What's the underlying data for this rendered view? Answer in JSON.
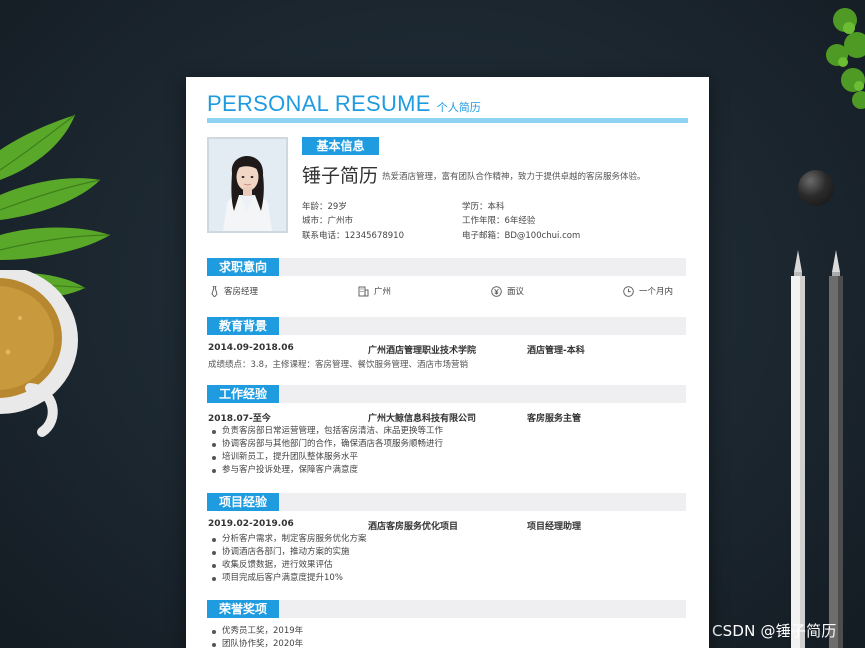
{
  "resume": {
    "title": "PERSONAL RESUME",
    "subtitle": "个人简历",
    "basic_section": "基本信息",
    "name": "锤子简历",
    "intro": "热爱酒店管理，富有团队合作精神，致力于提供卓越的客房服务体验。",
    "info": {
      "age": "年龄：29岁",
      "education": "学历：本科",
      "city": "城市：广州市",
      "years": "工作年限：6年经验",
      "phone": "联系电话：12345678910",
      "email": "电子邮箱：BD@100chui.com"
    },
    "intent_section": "求职意向",
    "intent": {
      "position": "客房经理",
      "location": "广州",
      "salary": "面议",
      "availability": "一个月内"
    },
    "education_section": "教育背景",
    "education": {
      "period": "2014.09-2018.06",
      "school": "广州酒店管理职业技术学院",
      "major": "酒店管理-本科",
      "detail": "成绩绩点：3.8，主修课程：客房管理、餐饮服务管理、酒店市场营销"
    },
    "work_section": "工作经验",
    "work": {
      "period": "2018.07-至今",
      "company": "广州大鲸信息科技有限公司",
      "role": "客房服务主管",
      "items": [
        "负责客房部日常运营管理，包括客房清洁、床品更换等工作",
        "协调客房部与其他部门的合作，确保酒店各项服务顺畅进行",
        "培训新员工，提升团队整体服务水平",
        "参与客户投诉处理，保障客户满意度"
      ]
    },
    "project_section": "项目经验",
    "project": {
      "period": "2019.02-2019.06",
      "name": "酒店客房服务优化项目",
      "role": "项目经理助理",
      "items": [
        "分析客户需求，制定客房服务优化方案",
        "协调酒店各部门，推动方案的实施",
        "收集反馈数据，进行效果评估",
        "项目完成后客户满意度提升10%"
      ]
    },
    "honor_section": "荣誉奖项",
    "honors": [
      "优秀员工奖，2019年",
      "团队协作奖，2020年"
    ]
  },
  "watermark": "CSDN @锤子简历",
  "colors": {
    "accent": "#1f9be0",
    "accent_light": "#8fd3f2",
    "section_bg": "#efeff1",
    "backdrop": "#1c2730"
  },
  "icons": {
    "position": "tie-icon",
    "location": "building-icon",
    "salary": "yen-circle-icon",
    "availability": "clock-icon"
  }
}
